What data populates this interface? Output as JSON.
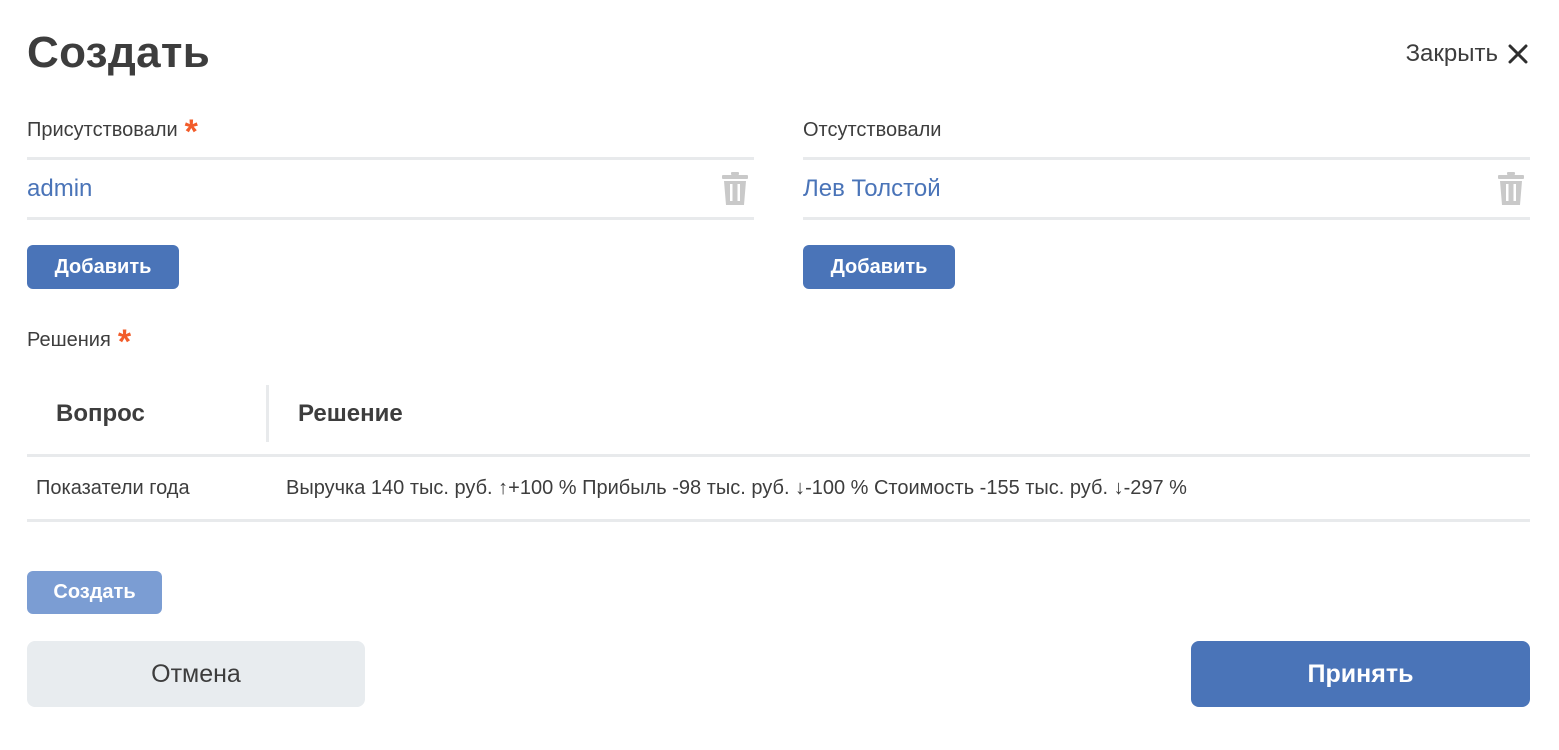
{
  "dialog": {
    "title": "Создать",
    "close_label": "Закрыть",
    "close_icon": "close-icon"
  },
  "present": {
    "label": "Присутствовали",
    "required_mark": "*",
    "members": [
      "admin"
    ],
    "add_label": "Добавить"
  },
  "absent": {
    "label": "Отсутствовали",
    "members": [
      "Лев Толстой"
    ],
    "add_label": "Добавить"
  },
  "decisions": {
    "label": "Решения",
    "required_mark": "*",
    "columns": [
      "Вопрос",
      "Решение"
    ],
    "rows": [
      {
        "question": "Показатели года",
        "decision": "Выручка 140 тыс. руб. ↑+100 % Прибыль -98 тыс. руб. ↓-100 % Стоимость -155 тыс. руб. ↓-297 %"
      }
    ],
    "create_label": "Создать"
  },
  "footer": {
    "cancel_label": "Отмена",
    "accept_label": "Принять"
  },
  "colors": {
    "accent": "#4a74b8",
    "required": "#f25c2a",
    "create_disabled": "#7b9dd3",
    "cancel_bg": "#e8ecef"
  }
}
